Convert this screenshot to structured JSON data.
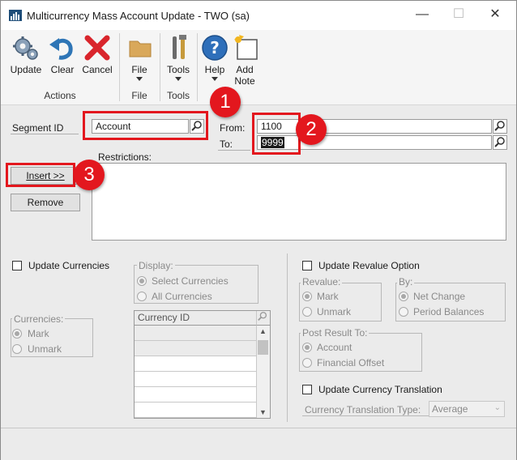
{
  "window": {
    "title": "Multicurrency Mass Account Update  -  TWO (sa)",
    "controls": {
      "minimize": "—",
      "maximize": "☐",
      "close": "✕"
    }
  },
  "ribbon": {
    "update": "Update",
    "clear": "Clear",
    "cancel": "Cancel",
    "file": "File",
    "tools": "Tools",
    "help": "Help",
    "add_note_1": "Add",
    "add_note_2": "Note",
    "groups": {
      "actions": "Actions",
      "file": "File",
      "tools": "Tools"
    }
  },
  "form": {
    "segment_id_label": "Segment ID",
    "segment_id_value": "Account",
    "from_label": "From:",
    "from_value": "1100",
    "to_label": "To:",
    "to_value": "9999",
    "restrictions_label": "Restrictions:",
    "insert_button": "Insert >>",
    "remove_button": "Remove"
  },
  "currencies": {
    "update_label": "Update Currencies",
    "group_label": "Currencies:",
    "mark": "Mark",
    "unmark": "Unmark",
    "display_label": "Display:",
    "select_currencies": "Select Currencies",
    "all_currencies": "All Currencies",
    "grid_header": "Currency ID"
  },
  "revalue": {
    "update_label": "Update Revalue Option",
    "revalue_label": "Revalue:",
    "mark": "Mark",
    "unmark": "Unmark",
    "by_label": "By:",
    "net_change": "Net Change",
    "period_balances": "Period Balances",
    "post_result_label": "Post Result To:",
    "account": "Account",
    "financial_offset": "Financial Offset"
  },
  "translation": {
    "update_label": "Update Currency Translation",
    "type_label": "Currency Translation Type:",
    "type_value": "Average"
  },
  "annotations": {
    "one": "1",
    "two": "2",
    "three": "3"
  },
  "colors": {
    "marker": "#e3171e",
    "form_bg": "#ebebeb",
    "ribbon_bg": "#f5f5f5"
  }
}
